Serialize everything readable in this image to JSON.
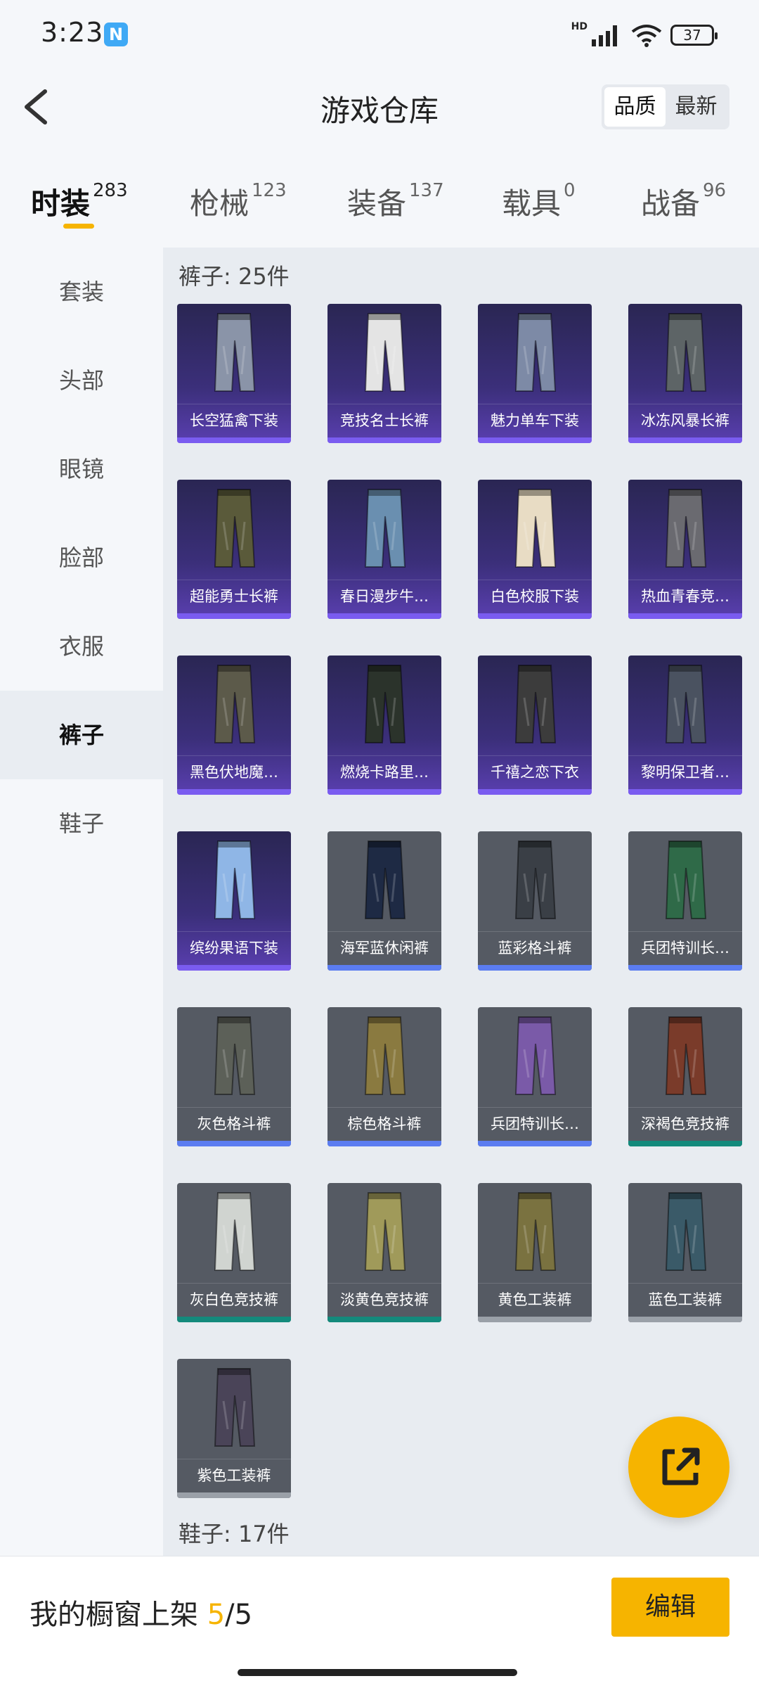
{
  "status": {
    "time": "3:23",
    "nfc": "N",
    "battery": "37",
    "network": "HD"
  },
  "header": {
    "title": "游戏仓库",
    "sort_options": [
      "品质",
      "最新"
    ],
    "sort_active": "品质"
  },
  "tabs": [
    {
      "label": "时装",
      "count": "283",
      "active": true
    },
    {
      "label": "枪械",
      "count": "123",
      "active": false
    },
    {
      "label": "装备",
      "count": "137",
      "active": false
    },
    {
      "label": "载具",
      "count": "0",
      "active": false
    },
    {
      "label": "战备",
      "count": "96",
      "active": false
    }
  ],
  "sidebar": {
    "items": [
      {
        "label": "套装",
        "active": false
      },
      {
        "label": "头部",
        "active": false
      },
      {
        "label": "眼镜",
        "active": false
      },
      {
        "label": "脸部",
        "active": false
      },
      {
        "label": "衣服",
        "active": false
      },
      {
        "label": "裤子",
        "active": true
      },
      {
        "label": "鞋子",
        "active": false
      }
    ]
  },
  "section": {
    "title": "裤子: 25件",
    "next_title": "鞋子: 17件"
  },
  "items": [
    {
      "name": "长空猛禽下装",
      "rarity": "purple",
      "color": "#8a94a8"
    },
    {
      "name": "竞技名士长裤",
      "rarity": "purple",
      "color": "#e4e4e4"
    },
    {
      "name": "魅力单车下装",
      "rarity": "purple",
      "color": "#7d8aa6"
    },
    {
      "name": "冰冻风暴长裤",
      "rarity": "purple",
      "color": "#5d6466"
    },
    {
      "name": "超能勇士长裤",
      "rarity": "purple",
      "color": "#5a5a3a"
    },
    {
      "name": "春日漫步牛…",
      "rarity": "purple",
      "color": "#6a8fb0"
    },
    {
      "name": "白色校服下装",
      "rarity": "purple",
      "color": "#e8dcc4"
    },
    {
      "name": "热血青春竞…",
      "rarity": "purple",
      "color": "#6a6a70"
    },
    {
      "name": "黑色伏地魔…",
      "rarity": "purple",
      "color": "#5c5a4a"
    },
    {
      "name": "燃烧卡路里…",
      "rarity": "purple",
      "color": "#2b332b"
    },
    {
      "name": "千禧之恋下衣",
      "rarity": "purple",
      "color": "#3c3c3c"
    },
    {
      "name": "黎明保卫者…",
      "rarity": "purple",
      "color": "#4a5260"
    },
    {
      "name": "缤纷果语下装",
      "rarity": "purple",
      "color": "#8fb6e6"
    },
    {
      "name": "海军蓝休闲裤",
      "rarity": "blue",
      "color": "#1e2a44"
    },
    {
      "name": "蓝彩格斗裤",
      "rarity": "blue",
      "color": "#3a3f46"
    },
    {
      "name": "兵团特训长…",
      "rarity": "blue",
      "color": "#2f6a48"
    },
    {
      "name": "灰色格斗裤",
      "rarity": "blue",
      "color": "#5c6058"
    },
    {
      "name": "棕色格斗裤",
      "rarity": "blue",
      "color": "#8a7a40"
    },
    {
      "name": "兵团特训长…",
      "rarity": "blue",
      "color": "#7a5aa8"
    },
    {
      "name": "深褐色竞技裤",
      "rarity": "teal",
      "color": "#7a3b2a"
    },
    {
      "name": "灰白色竞技裤",
      "rarity": "teal",
      "color": "#d0d4d0"
    },
    {
      "name": "淡黄色竞技裤",
      "rarity": "teal",
      "color": "#a09a5a"
    },
    {
      "name": "黄色工装裤",
      "rarity": "gray",
      "color": "#7a7240"
    },
    {
      "name": "蓝色工装裤",
      "rarity": "gray",
      "color": "#3a5a68"
    },
    {
      "name": "紫色工装裤",
      "rarity": "gray",
      "color": "#4a4458"
    }
  ],
  "bottom": {
    "label_prefix": "我的橱窗上架",
    "current": "5",
    "total": "/5",
    "edit_label": "编辑"
  },
  "colors": {
    "accent": "#f6b400",
    "purple_frame": "#7a5cf0",
    "blue_frame": "#5b7cf0",
    "teal_frame": "#138a7c"
  }
}
